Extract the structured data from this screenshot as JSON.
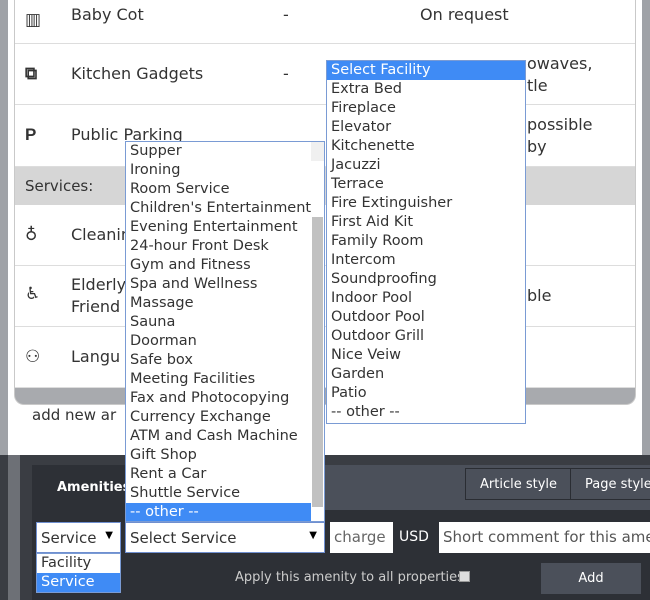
{
  "facilities_rows": [
    {
      "icon": "baby-cot-icon",
      "name": "Baby Cot",
      "charge": "-",
      "comment": "On request"
    },
    {
      "icon": "kitchen-icon",
      "name": "Kitchen Gadgets",
      "charge": "-",
      "comment": "owaves,",
      "comment2": "tle"
    },
    {
      "icon": "parking-icon",
      "name": "Public Parking",
      "charge": "",
      "comment": "possible",
      "comment2": "by"
    }
  ],
  "services_header": "Services:",
  "services_rows": [
    {
      "icon": "cleaning-icon",
      "name": "Cleanin"
    },
    {
      "icon": "elderly-icon",
      "name": "Elderly",
      "name2": "Friend",
      "comment": "ble"
    },
    {
      "icon": "language-icon",
      "name": "Langu"
    }
  ],
  "add_new": "add new ar",
  "tabs": {
    "amenities": "Amenities",
    "article_style": "Article style",
    "page_style": "Page style"
  },
  "form": {
    "type_value": "Service",
    "type_options": [
      "Facility",
      "Service"
    ],
    "service_value": "Select Service",
    "charge_placeholder": "charge",
    "currency": "USD",
    "comment_placeholder": "Short comment for this amenity",
    "apply_label": "Apply this amenity to all properties:",
    "apply_checked": false,
    "add_label": "Add"
  },
  "service_options": [
    "Supper",
    "Ironing",
    "Room Service",
    "Children's Entertainment",
    "Evening Entertainment",
    "24-hour Front Desk",
    "Gym and Fitness",
    "Spa and Wellness",
    "Massage",
    "Sauna",
    "Doorman",
    "Safe box",
    "Meeting Facilities",
    "Fax and Photocopying",
    "Currency Exchange",
    "ATM and Cash Machine",
    "Gift Shop",
    "Rent a Car",
    "Shuttle Service",
    "-- other --"
  ],
  "service_selected": "-- other --",
  "facility_options": [
    "Select Facility",
    "Extra Bed",
    "Fireplace",
    "Elevator",
    "Kitchenette",
    "Jacuzzi",
    "Terrace",
    "Fire Extinguisher",
    "First Aid Kit",
    "Family Room",
    "Intercom",
    "Soundproofing",
    "Indoor Pool",
    "Outdoor Pool",
    "Outdoor Grill",
    "Nice Veiw",
    "Garden",
    "Patio",
    "-- other --"
  ],
  "facility_selected": "Select Facility",
  "colors": {
    "highlight": "#3f8bf5",
    "dark_bg": "#2d3036"
  }
}
